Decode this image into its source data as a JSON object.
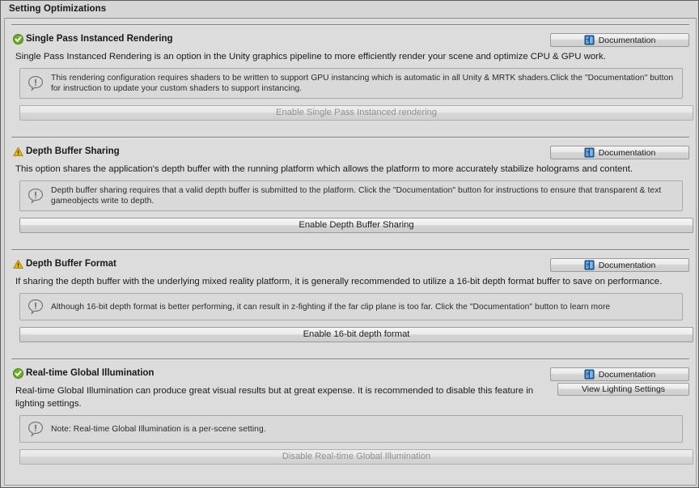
{
  "window": {
    "title": "Setting Optimizations"
  },
  "icons": {
    "success": "green-check-icon",
    "warning": "yellow-warning-icon",
    "help": "info-exclamation-icon",
    "documentation": "blue-book-question-icon"
  },
  "colors": {
    "success_green": "#6eab2a",
    "warning_yellow": "#e8b213",
    "panel_bg": "#dcdcdc",
    "window_bg": "#d6d6d6",
    "helpbox_bg": "#d9d9d9",
    "border": "#9b9b9b",
    "text": "#1b1b1b",
    "text_disabled": "#8f8f8f",
    "doc_icon_blue": "#2a6fb5"
  },
  "sections": [
    {
      "id": "single-pass-instanced-rendering",
      "title": "Single Pass Instanced Rendering",
      "status": "success",
      "doc_button": "Documentation",
      "description": "Single Pass Instanced Rendering is an option in the Unity graphics pipeline to more efficiently render your scene and optimize CPU & GPU work.",
      "help_text": "This rendering configuration requires shaders to be written to support GPU instancing which is automatic in all Unity & MRTK shaders.Click the \"Documentation\" button for instruction to update your custom shaders to support instancing.",
      "action_button": "Enable Single Pass Instanced rendering",
      "action_enabled": false,
      "extra_button": null
    },
    {
      "id": "depth-buffer-sharing",
      "title": "Depth Buffer Sharing",
      "status": "warning",
      "doc_button": "Documentation",
      "description": "This option shares the application's depth buffer with the running platform which allows the platform to more accurately stabilize holograms and content.",
      "help_text": "Depth buffer sharing requires that a valid depth buffer is submitted to the platform. Click the \"Documentation\" button for instructions to ensure that transparent & text gameobjects write to depth.",
      "action_button": "Enable Depth Buffer Sharing",
      "action_enabled": true,
      "extra_button": null
    },
    {
      "id": "depth-buffer-format",
      "title": "Depth Buffer Format",
      "status": "warning",
      "doc_button": "Documentation",
      "description": "If sharing the depth buffer with the underlying mixed reality platform, it is generally recommended to utilize a 16-bit depth format buffer to save on performance.",
      "help_text": "Although 16-bit depth format is better performing, it can result in z-fighting if the far clip plane is too far. Click the \"Documentation\" button to learn more",
      "action_button": "Enable 16-bit depth format",
      "action_enabled": true,
      "extra_button": null
    },
    {
      "id": "real-time-global-illumination",
      "title": "Real-time Global Illumination",
      "status": "success",
      "doc_button": "Documentation",
      "description": "Real-time Global Illumination can produce great visual results but at great expense. It is recommended to disable this feature in lighting settings.",
      "help_text": "Note: Real-time Global Illumination is a per-scene setting.",
      "action_button": "Disable Real-time Global Illumination",
      "action_enabled": false,
      "extra_button": "View Lighting Settings"
    }
  ]
}
